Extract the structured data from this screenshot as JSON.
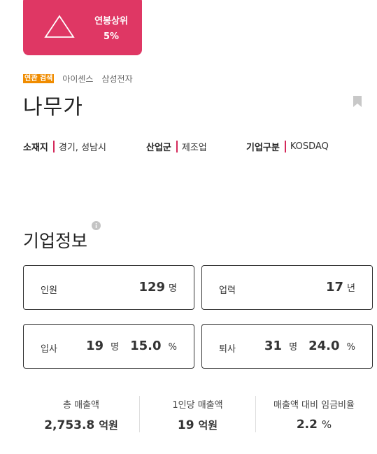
{
  "salary_card": {
    "line1": "연봉상위",
    "line2": "5%",
    "bg_color": "#df3764",
    "icon": "mountain-triangle-icon"
  },
  "related": {
    "tag": "연관 검색",
    "keywords": [
      "아이센스",
      "삼성전자"
    ]
  },
  "company": {
    "name": "나무가",
    "bookmark_icon": "bookmark-icon"
  },
  "meta": [
    {
      "key": "소재지",
      "value": "경기, 성남시"
    },
    {
      "key": "산업군",
      "value": "제조업"
    },
    {
      "key": "기업구분",
      "value": "KOSDAQ"
    }
  ],
  "section": {
    "title": "기업정보",
    "info_icon": "info-icon"
  },
  "cards": {
    "employees": {
      "label": "인원",
      "value": "129",
      "unit": "명"
    },
    "years": {
      "label": "업력",
      "value": "17",
      "unit": "년"
    },
    "hires": {
      "label": "입사",
      "count": "19",
      "count_unit": "명",
      "rate": "15.0",
      "rate_unit": "%"
    },
    "leaves": {
      "label": "퇴사",
      "count": "31",
      "count_unit": "명",
      "rate": "24.0",
      "rate_unit": "%"
    }
  },
  "stats": [
    {
      "title": "총 매출액",
      "value": "2,753.8",
      "unit": "억원"
    },
    {
      "title": "1인당 매출액",
      "value": "19",
      "unit": "억원"
    },
    {
      "title": "매출액 대비 임금비율",
      "value": "2.2",
      "unit": "%"
    }
  ],
  "accent_color": "#d4285a"
}
